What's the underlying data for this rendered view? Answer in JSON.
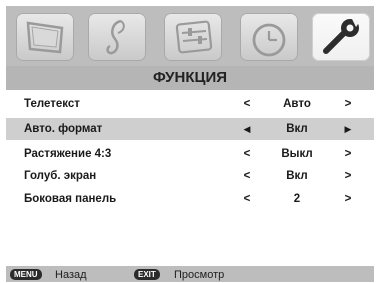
{
  "tabs": [
    {
      "icon": "tv-icon",
      "active": false
    },
    {
      "icon": "music-note-icon",
      "active": false
    },
    {
      "icon": "equalizer-icon",
      "active": false
    },
    {
      "icon": "clock-icon",
      "active": false
    },
    {
      "icon": "wrench-icon",
      "active": true
    }
  ],
  "menu": {
    "title": "ФУНКЦИЯ",
    "items": [
      {
        "label": "Телетекст",
        "value": "Авто",
        "left_arrow": "<",
        "right_arrow": ">"
      },
      {
        "label": "Авто. формат",
        "value": "Вкл",
        "left_arrow": "◀",
        "right_arrow": "▶"
      },
      {
        "label": "Растяжение 4:3",
        "value": "Выкл",
        "left_arrow": "<",
        "right_arrow": ">"
      },
      {
        "label": "Голуб. экран",
        "value": "Вкл",
        "left_arrow": "<",
        "right_arrow": ">"
      },
      {
        "label": "Боковая панель",
        "value": "2",
        "left_arrow": "<",
        "right_arrow": ">"
      }
    ]
  },
  "footer": {
    "menu_key": "MENU",
    "menu_text": "Назад",
    "exit_key": "EXIT",
    "exit_text": "Просмотр"
  },
  "colors": {
    "background": "#ffffff",
    "bar": "#bdbdbd",
    "highlight": "#cfcfcf",
    "text": "#1a1a1a"
  }
}
